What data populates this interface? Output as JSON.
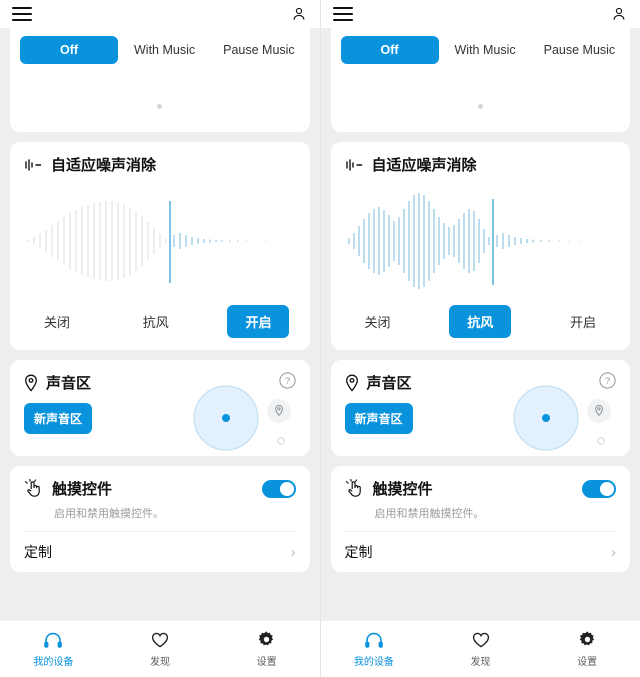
{
  "topbar": {
    "menu_icon": "hamburger-icon",
    "account_icon": "person-icon"
  },
  "segmented": {
    "options": [
      "Off",
      "With Music",
      "Pause Music"
    ],
    "selected": "Off",
    "pager_dot": "page-dot"
  },
  "anc_card": {
    "icon": "waveform-icon",
    "title": "自适应噪声消除",
    "buttons": [
      "关闭",
      "抗风",
      "开启"
    ],
    "selected_left": "开启",
    "selected_right": "抗风"
  },
  "zone_card": {
    "icon": "location-pin-icon",
    "title": "声音区",
    "help_icon": "question-mark-icon",
    "chip_label": "新声音区",
    "marker_icon": "location-pin-small-icon"
  },
  "touch_card": {
    "icon": "touch-hand-icon",
    "title": "触摸控件",
    "toggle_state": "on",
    "subtitle": "启用和禁用触摸控件。",
    "row_label": "定制",
    "chevron": "chevron-right-icon"
  },
  "bottomnav": {
    "items": [
      {
        "label": "我的设备",
        "icon": "headphones-icon",
        "active": true
      },
      {
        "label": "发现",
        "icon": "heart-icon",
        "active": false
      },
      {
        "label": "设置",
        "icon": "gear-icon",
        "active": false
      }
    ]
  },
  "colors": {
    "accent": "#0a93dd",
    "background": "#eceeef",
    "card": "#ffffff",
    "muted_text": "#9a9da0"
  }
}
